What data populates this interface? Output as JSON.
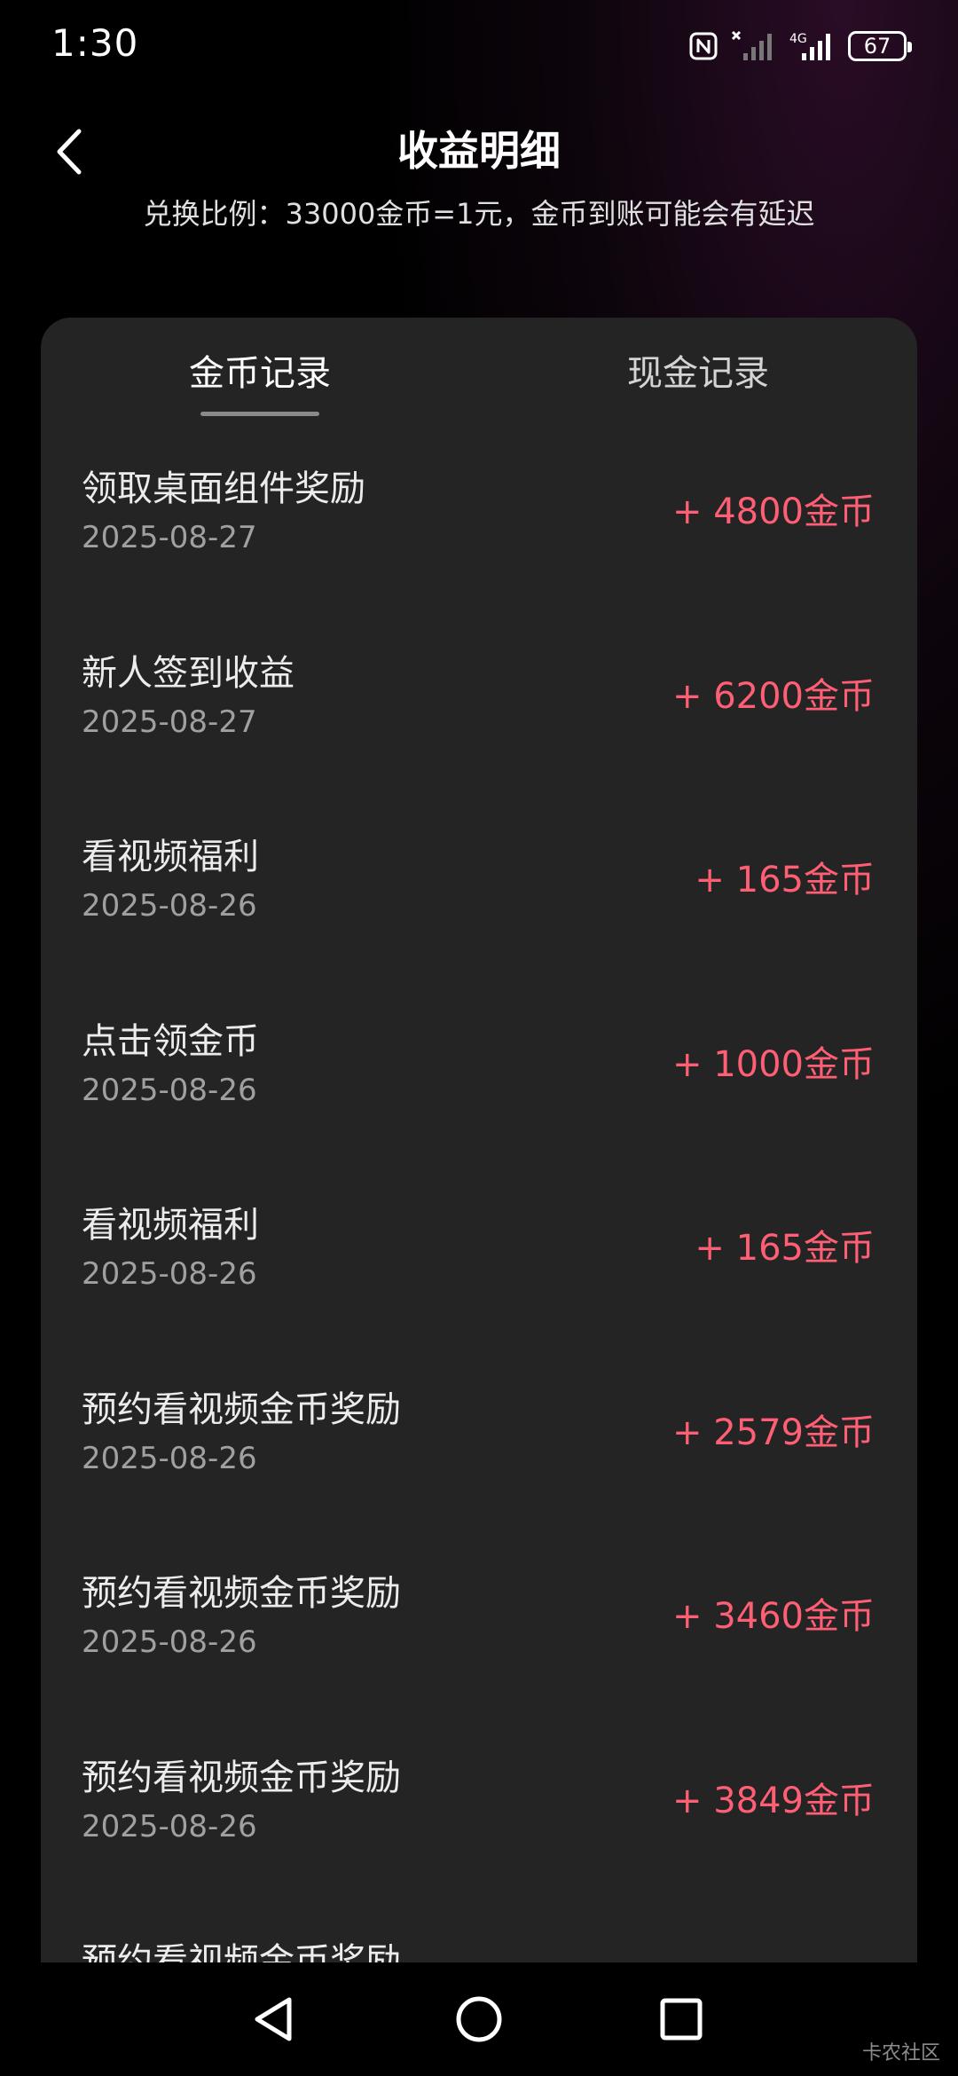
{
  "status_bar": {
    "time": "1:30",
    "battery": "67",
    "network": "4G"
  },
  "header": {
    "title": "收益明细",
    "exchange_note": "兑换比例：33000金币=1元，金币到账可能会有延迟"
  },
  "tabs": [
    {
      "label": "金币记录",
      "active": true
    },
    {
      "label": "现金记录",
      "active": false
    }
  ],
  "records": [
    {
      "title": "领取桌面组件奖励",
      "date": "2025-08-27",
      "amount": "+ 4800金币"
    },
    {
      "title": "新人签到收益",
      "date": "2025-08-27",
      "amount": "+ 6200金币"
    },
    {
      "title": "看视频福利",
      "date": "2025-08-26",
      "amount": "+ 165金币"
    },
    {
      "title": "点击领金币",
      "date": "2025-08-26",
      "amount": "+ 1000金币"
    },
    {
      "title": "看视频福利",
      "date": "2025-08-26",
      "amount": "+ 165金币"
    },
    {
      "title": "预约看视频金币奖励",
      "date": "2025-08-26",
      "amount": "+ 2579金币"
    },
    {
      "title": "预约看视频金币奖励",
      "date": "2025-08-26",
      "amount": "+ 3460金币"
    },
    {
      "title": "预约看视频金币奖励",
      "date": "2025-08-26",
      "amount": "+ 3849金币"
    },
    {
      "title": "预约看视频金币奖励",
      "date": "",
      "amount": ""
    }
  ],
  "watermark": "卡农社区",
  "colors": {
    "amount": "#ff5f74",
    "card": "#242424",
    "background": "#000000"
  },
  "icons": {
    "back": "chevron-left-icon",
    "nav_back": "triangle-back-icon",
    "nav_home": "circle-home-icon",
    "nav_recents": "square-recents-icon"
  }
}
